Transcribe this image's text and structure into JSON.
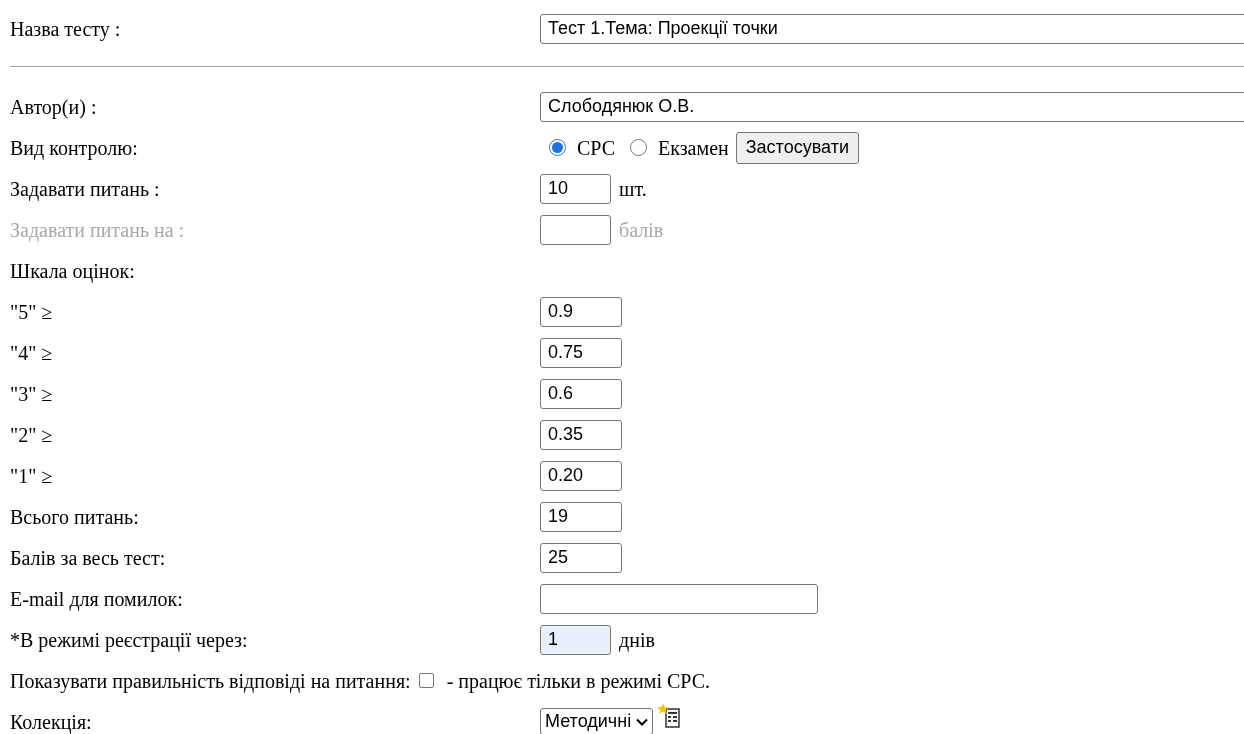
{
  "rows": [
    {
      "kind": "wide",
      "label": "Назва тесту :",
      "value": "Тест 1.Тема: Проекції точки"
    },
    {
      "kind": "rule"
    },
    {
      "kind": "wide",
      "label": "Автор(и) :",
      "value": "Слободянюк О.В."
    },
    {
      "kind": "radio",
      "label": "Вид контролю:",
      "options": [
        {
          "label": "СРС",
          "selected": true
        },
        {
          "label": "Екзамен",
          "selected": false
        }
      ],
      "button": "Застосувати"
    },
    {
      "kind": "short",
      "label": "Задавати питань :",
      "value": "10",
      "suffix": "шт.",
      "disabled": false,
      "autofilled": false
    },
    {
      "kind": "short",
      "label": "Задавати питань на :",
      "suffix": "балів",
      "disabled": true,
      "autofilled": false
    },
    {
      "kind": "heading",
      "label": "Шкала оцінок:"
    },
    {
      "kind": "score",
      "label": "\"5\" ≥",
      "value": "0.9"
    },
    {
      "kind": "score",
      "label": "\"4\" ≥",
      "value": "0.75"
    },
    {
      "kind": "score",
      "label": "\"3\" ≥",
      "value": "0.6"
    },
    {
      "kind": "score",
      "label": "\"2\" ≥",
      "value": "0.35"
    },
    {
      "kind": "score",
      "label": "\"1\" ≥",
      "value": "0.20"
    },
    {
      "kind": "score",
      "label": "Всього питань:",
      "value": "19"
    },
    {
      "kind": "score",
      "label": "Балів за весь тест:",
      "value": "25"
    },
    {
      "kind": "email",
      "label": "E-mail для помилок:"
    },
    {
      "kind": "short",
      "label": "*В режимі реєстрації через:",
      "value": "1",
      "suffix": "днів",
      "disabled": false,
      "autofilled": true
    },
    {
      "kind": "checkbox",
      "label": "Показувати правильність відповіді на питання:",
      "checked": false,
      "note": "- працює тільки в режимі СРС."
    },
    {
      "kind": "select",
      "label": "Колекція:",
      "value": "Методичні"
    }
  ]
}
